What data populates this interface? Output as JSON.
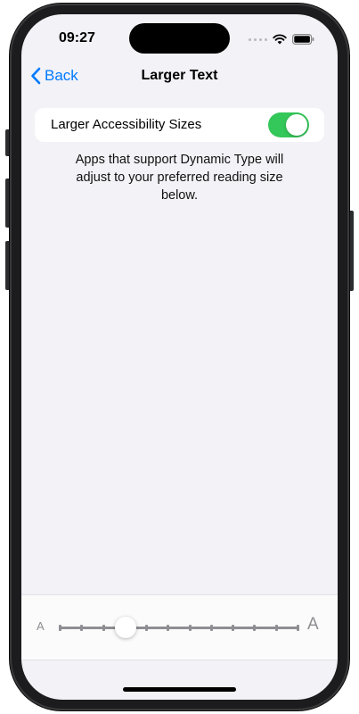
{
  "status_bar": {
    "time": "09:27",
    "icons": [
      "cellular-signal-icon",
      "wifi-icon",
      "battery-icon"
    ]
  },
  "nav": {
    "back_label": "Back",
    "title": "Larger Text"
  },
  "settings": {
    "larger_sizes_label": "Larger Accessibility Sizes",
    "larger_sizes_enabled": true,
    "description": "Apps that support Dynamic Type will adjust to your preferred reading size below."
  },
  "text_size_slider": {
    "small_label": "A",
    "large_label": "A",
    "step_count": 12,
    "selected_step": 3
  },
  "colors": {
    "accent": "#007aff",
    "toggle_on": "#34c759",
    "background": "#f2f2f7"
  }
}
